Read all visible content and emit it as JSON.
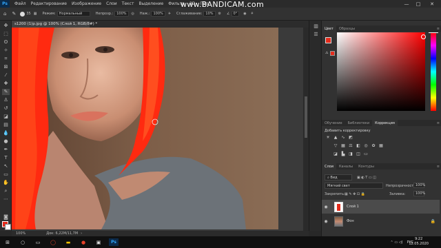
{
  "app": {
    "logo": "Ps",
    "menu": [
      "Файл",
      "Редактирование",
      "Изображение",
      "Слои",
      "Текст",
      "Выделение",
      "Фильтр",
      "3D",
      "Про"
    ],
    "watermark": "www.BANDICAM.com",
    "window_controls": [
      "—",
      "□",
      "✕"
    ]
  },
  "options_bar": {
    "brush_size": "35",
    "mode_label": "Режим:",
    "mode_value": "Нормальный",
    "opacity_label": "Непрозр.:",
    "opacity_value": "100%",
    "flow_label": "Наж.:",
    "flow_value": "100%",
    "smoothing_label": "Сглаживание:",
    "smoothing_value": "10%",
    "angle_value": "0°"
  },
  "document": {
    "tab_title": "s1200 (1)p.jpg @ 100% (Слой 1, RGB/8#) *",
    "zoom": "100%",
    "doc_info": "Док: 6,22М/11,7М"
  },
  "color_panel": {
    "tabs": [
      "Цвет",
      "Образцы"
    ],
    "foreground": "#e52b1b",
    "background": "#ffffff"
  },
  "adjustments_panel": {
    "tabs": [
      "Обучение",
      "Библиотеки",
      "Коррекция"
    ],
    "active_tab": "Коррекция",
    "add_label": "Добавить корректировку",
    "row1_icons": [
      "brightness-icon",
      "levels-icon",
      "curves-icon",
      "exposure-icon"
    ],
    "row2_icons": [
      "vibrance-icon",
      "hue-icon",
      "color-balance-icon",
      "bw-icon",
      "photo-filter-icon",
      "channel-mixer-icon",
      "lookup-icon"
    ],
    "row3_icons": [
      "invert-icon",
      "posterize-icon",
      "threshold-icon",
      "selective-color-icon",
      "gradient-map-icon"
    ]
  },
  "layers_panel": {
    "tabs": [
      "Слои",
      "Каналы",
      "Контуры"
    ],
    "kind_label": "Вид",
    "blend_mode": "Мягкий свет",
    "opacity_label": "Непрозрачность:",
    "opacity_value": "100%",
    "lock_label": "Закрепить:",
    "fill_label": "Заливка:",
    "fill_value": "100%",
    "layers": [
      {
        "name": "Слой 1",
        "selected": true
      },
      {
        "name": "Фон",
        "selected": false
      }
    ]
  },
  "taskbar": {
    "time": "9:22",
    "date": "12.05.2020",
    "lang": "РУС"
  }
}
